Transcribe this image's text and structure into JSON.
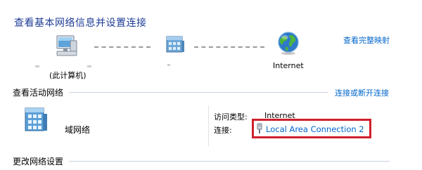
{
  "heading": "查看基本网络信息并设置连接",
  "see_full_map": "查看完整映射",
  "map": {
    "computer_label": "(此计算机)",
    "internet_label": "Internet"
  },
  "active_networks": {
    "title": "查看活动网络",
    "connect_link": "连接或断开连接",
    "network_name": "域网络",
    "access_type_label": "访问类型:",
    "access_type_value": "Internet",
    "connections_label": "连接:",
    "connection_name": "Local Area Connection 2"
  },
  "change_settings": {
    "title": "更改网络设置"
  },
  "colors": {
    "heading": "#1e3c96",
    "link": "#0066cc",
    "highlight": "#d0202e"
  }
}
